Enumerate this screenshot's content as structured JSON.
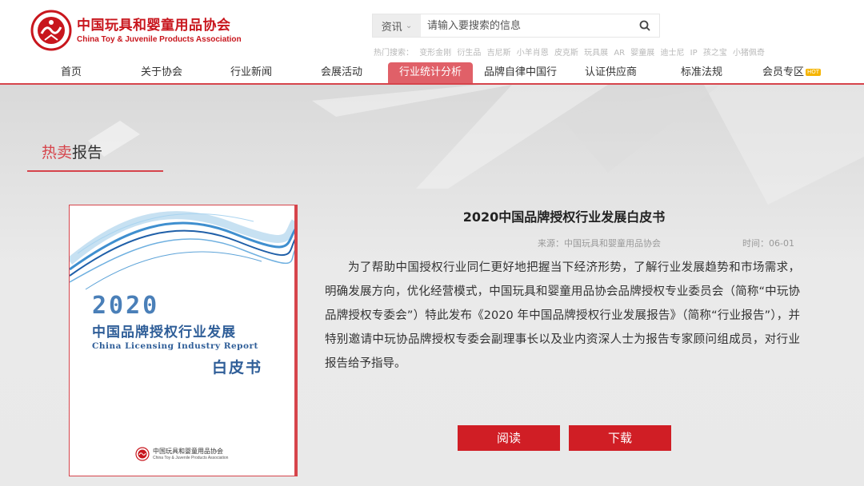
{
  "header": {
    "logo_cn": "中国玩具和婴童用品协会",
    "logo_en": "China Toy & Juvenile Products Association",
    "search": {
      "category": "资讯",
      "placeholder": "请输入要搜索的信息"
    },
    "hot_search": {
      "label": "热门搜索：",
      "terms": [
        "变形金刚",
        "衍生品",
        "吉尼斯",
        "小羊肖恩",
        "皮克斯",
        "玩具展",
        "AR",
        "婴童展",
        "迪士尼",
        "IP",
        "孩之宝",
        "小猪佩奇"
      ]
    }
  },
  "nav": {
    "items": [
      {
        "label": "首页"
      },
      {
        "label": "关于协会"
      },
      {
        "label": "行业新闻"
      },
      {
        "label": "会展活动"
      },
      {
        "label": "行业统计分析",
        "active": true
      },
      {
        "label": "品牌自律中国行"
      },
      {
        "label": "认证供应商"
      },
      {
        "label": "标准法规"
      },
      {
        "label": "会员专区",
        "badge": "HOT"
      }
    ]
  },
  "section": {
    "title_highlight": "热卖",
    "title_rest": "报告"
  },
  "cover": {
    "year": "2020",
    "title": "中国品牌授权行业发展",
    "title_en": "China Licensing Industry Report",
    "subtitle": "白皮书",
    "footer_cn": "中国玩具和婴童用品协会",
    "footer_en": "China Toy & Juvenile Products Association"
  },
  "article": {
    "title": "2020中国品牌授权行业发展白皮书",
    "source": "来源：中国玩具和婴童用品协会",
    "time": "时间：06-01",
    "body": "为了帮助中国授权行业同仁更好地把握当下经济形势，了解行业发展趋势和市场需求，明确发展方向，优化经营模式，中国玩具和婴童用品协会品牌授权专业委员会（简称“中玩协品牌授权专委会”）特此发布《2020 年中国品牌授权行业发展报告》（简称“行业报告”），并特别邀请中玩协品牌授权专委会副理事长以及业内资深人士为报告专家顾问组成员，对行业报告给予指导。",
    "read_label": "阅读",
    "download_label": "下载"
  },
  "colors": {
    "brand_red": "#c8161d",
    "button_red": "#d01e25",
    "nav_active": "#e06068",
    "cover_blue": "#2f5e98"
  }
}
